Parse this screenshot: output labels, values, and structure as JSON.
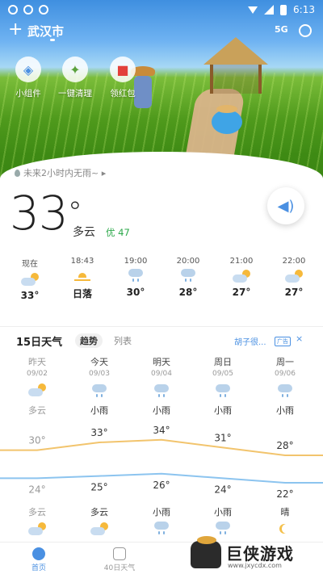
{
  "status_bar": {
    "time": "6:13"
  },
  "header": {
    "city": "武汉市",
    "share_label": "5G"
  },
  "quick_actions": [
    {
      "label": "小组件",
      "icon": "layers-icon"
    },
    {
      "label": "一键清理",
      "icon": "broom-icon"
    },
    {
      "label": "领红包",
      "icon": "red-packet-icon"
    }
  ],
  "current": {
    "rain_notice": "未来2小时内无雨~",
    "temperature": "33",
    "degree": "°",
    "condition": "多云",
    "aqi": "优 47"
  },
  "hourly": [
    {
      "time": "现在",
      "icon": "partly-cloudy-icon",
      "temp": "33°"
    },
    {
      "time": "18:43",
      "icon": "sunset-icon",
      "temp": "日落"
    },
    {
      "time": "19:00",
      "icon": "rain-icon",
      "temp": "30°"
    },
    {
      "time": "20:00",
      "icon": "rain-icon",
      "temp": "28°"
    },
    {
      "time": "21:00",
      "icon": "partly-cloudy-icon",
      "temp": "27°"
    },
    {
      "time": "22:00",
      "icon": "partly-cloudy-icon",
      "temp": "27°"
    }
  ],
  "forecast": {
    "title": "15日天气",
    "tab_trend": "趋势",
    "tab_list": "列表",
    "ad_text": "胡子很...",
    "ad_tag": "广告",
    "ad_close": "×",
    "days": [
      {
        "name": "昨天",
        "date": "09/02",
        "day_icon": "partly-cloudy-icon",
        "day_cond": "多云",
        "high": "30°",
        "low": "24°",
        "night_cond": "多云",
        "night_icon": "partly-cloudy-icon",
        "past": true
      },
      {
        "name": "今天",
        "date": "09/03",
        "day_icon": "rain-icon",
        "day_cond": "小雨",
        "high": "33°",
        "low": "25°",
        "night_cond": "多云",
        "night_icon": "partly-cloudy-icon",
        "past": false
      },
      {
        "name": "明天",
        "date": "09/04",
        "day_icon": "rain-icon",
        "day_cond": "小雨",
        "high": "34°",
        "low": "26°",
        "night_cond": "小雨",
        "night_icon": "rain-icon",
        "past": false
      },
      {
        "name": "周日",
        "date": "09/05",
        "day_icon": "rain-icon",
        "day_cond": "小雨",
        "high": "31°",
        "low": "24°",
        "night_cond": "小雨",
        "night_icon": "rain-icon",
        "past": false
      },
      {
        "name": "周一",
        "date": "09/06",
        "day_icon": "rain-icon",
        "day_cond": "小雨",
        "high": "28°",
        "low": "22°",
        "night_cond": "晴",
        "night_icon": "moon-icon",
        "past": false
      }
    ]
  },
  "bottom_nav": [
    {
      "label": "首页",
      "active": true
    },
    {
      "label": "40日天气",
      "active": false
    }
  ],
  "watermark": {
    "text": "巨侠游戏",
    "url": "www.jxycdx.com"
  },
  "colors": {
    "accent": "#4a90e2",
    "aqi_good": "#2ca84a",
    "high_line": "#f2c46d",
    "low_line": "#8cc4ef"
  }
}
